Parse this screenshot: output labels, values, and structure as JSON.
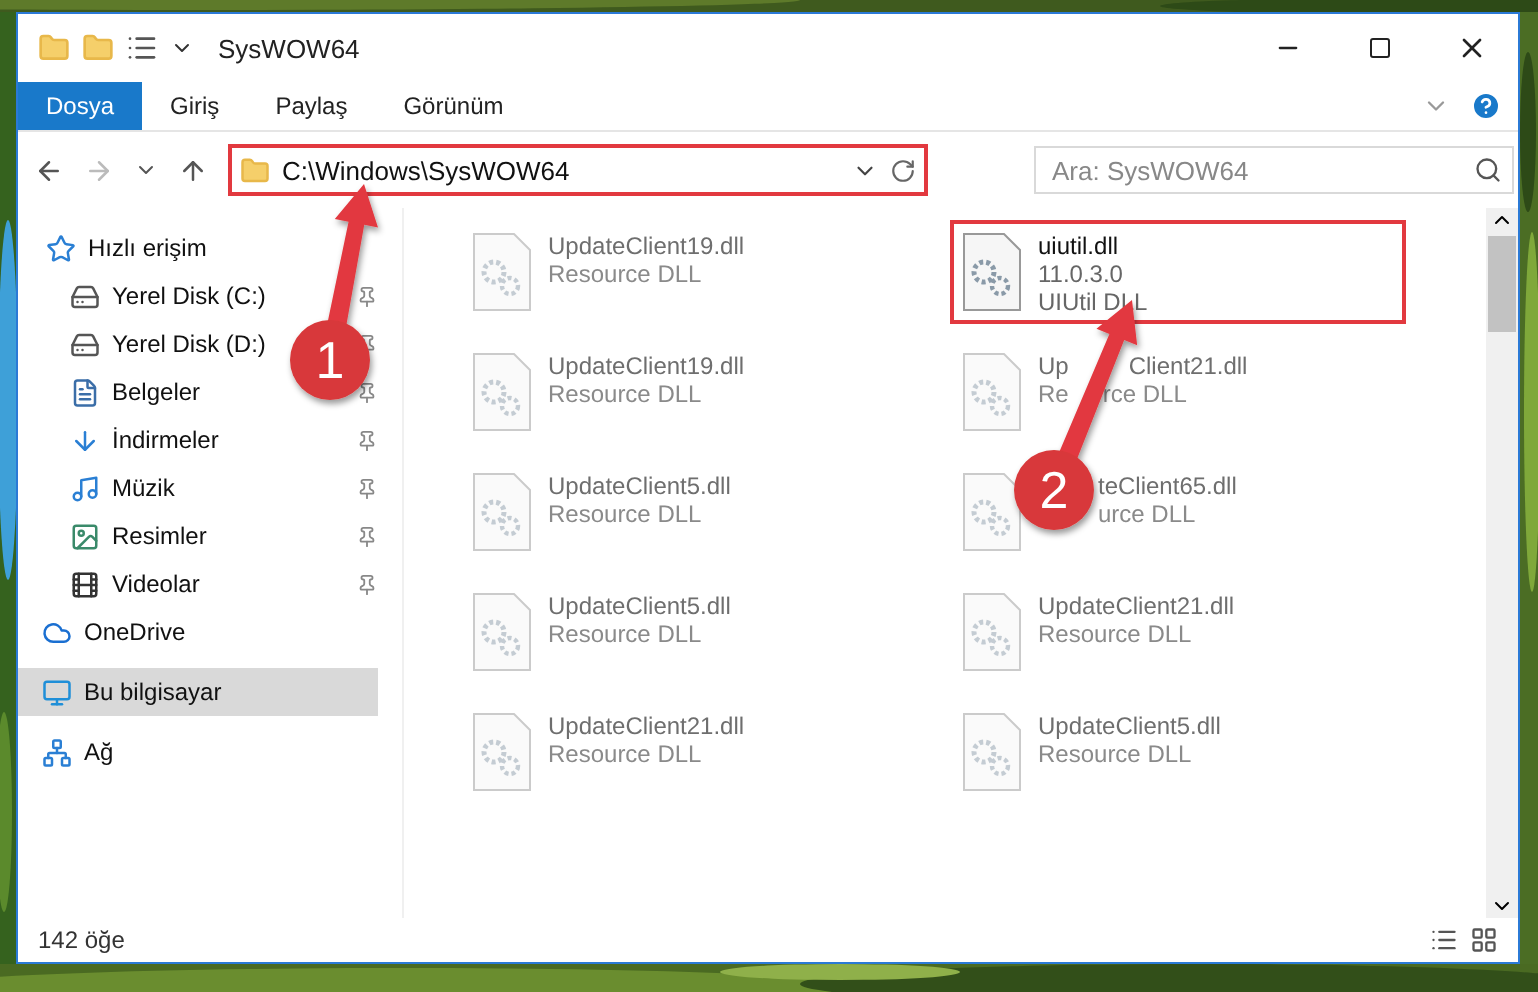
{
  "window": {
    "title": "SysWOW64"
  },
  "ribbon_tabs": [
    {
      "label": "Dosya",
      "selected": true
    },
    {
      "label": "Giriş",
      "selected": false
    },
    {
      "label": "Paylaş",
      "selected": false
    },
    {
      "label": "Görünüm",
      "selected": false
    }
  ],
  "address": {
    "path": "C:\\Windows\\SysWOW64",
    "highlighted": true
  },
  "search": {
    "placeholder": "Ara: SysWOW64"
  },
  "navigation": [
    {
      "label": "Hızlı erişim",
      "selected": false,
      "children": [
        {
          "label": "Yerel Disk (C:)",
          "pinned": true,
          "selected": false
        },
        {
          "label": "Yerel Disk (D:)",
          "pinned": true,
          "selected": false
        },
        {
          "label": "Belgeler",
          "pinned": true,
          "selected": false
        },
        {
          "label": "İndirmeler",
          "pinned": true,
          "selected": false
        },
        {
          "label": "Müzik",
          "pinned": true,
          "selected": false
        },
        {
          "label": "Resimler",
          "pinned": true,
          "selected": false
        },
        {
          "label": "Videolar",
          "pinned": true,
          "selected": false
        }
      ]
    },
    {
      "label": "OneDrive",
      "selected": false
    },
    {
      "label": "Bu bilgisayar",
      "selected": true
    },
    {
      "label": "Ağ",
      "selected": false
    }
  ],
  "files": [
    {
      "name": "UpdateClient19.dll",
      "details": [
        "Resource DLL"
      ],
      "blurred": true,
      "highlighted": false
    },
    {
      "name": "uiutil.dll",
      "details": [
        "11.0.3.0",
        "UIUtil DLL"
      ],
      "blurred": false,
      "highlighted": true
    },
    {
      "name": "UpdateClient19.dll",
      "details": [
        "Resource DLL"
      ],
      "blurred": true,
      "highlighted": false
    },
    {
      "name": [
        "Up",
        "Client21.dll"
      ],
      "details": [
        [
          "Re",
          "rce DLL"
        ]
      ],
      "blurred": true,
      "highlighted": false
    },
    {
      "name": "UpdateClient5.dll",
      "details": [
        "Resource DLL"
      ],
      "blurred": true,
      "highlighted": false
    },
    {
      "name": "teClient65.dll",
      "details": [
        "urce DLL"
      ],
      "blurred": true,
      "highlighted": false,
      "covered_start": true
    },
    {
      "name": "UpdateClient5.dll",
      "details": [
        "Resource DLL"
      ],
      "blurred": true,
      "highlighted": false
    },
    {
      "name": "UpdateClient21.dll",
      "details": [
        "Resource DLL"
      ],
      "blurred": true,
      "highlighted": false
    },
    {
      "name": "UpdateClient21.dll",
      "details": [
        "Resource DLL"
      ],
      "blurred": true,
      "highlighted": false
    },
    {
      "name": "UpdateClient5.dll",
      "details": [
        "Resource DLL"
      ],
      "blurred": true,
      "highlighted": false
    }
  ],
  "status_bar": {
    "count": "142 öğe"
  },
  "callouts": [
    {
      "number": "1"
    },
    {
      "number": "2"
    }
  ]
}
